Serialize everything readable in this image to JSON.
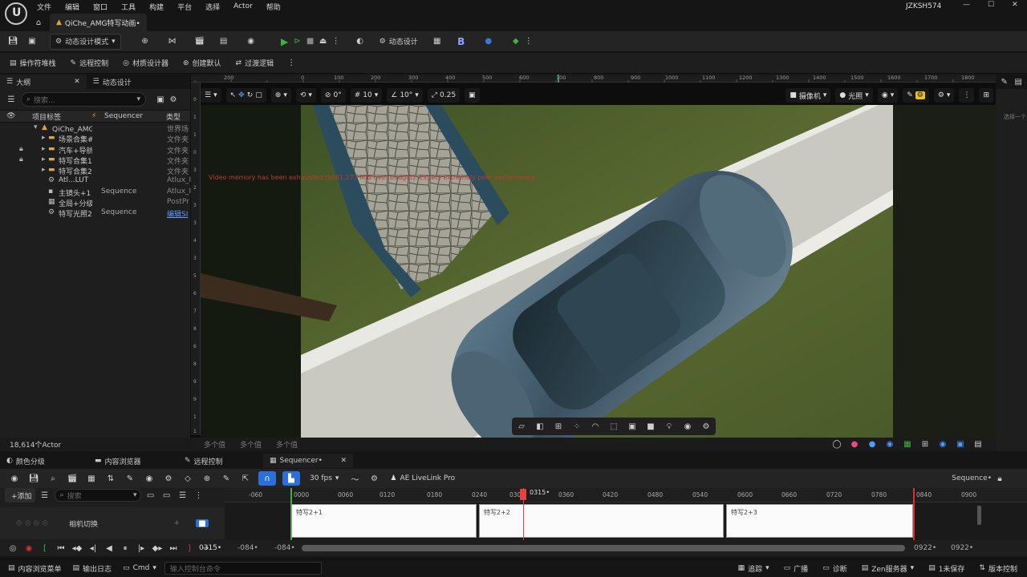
{
  "menu": [
    "文件",
    "编辑",
    "窗口",
    "工具",
    "构建",
    "平台",
    "选择",
    "Actor",
    "帮助"
  ],
  "user": "JZKSH574",
  "window_controls": [
    "—",
    "☐",
    "✕"
  ],
  "doc_tab": "QiChe_AMG特写动画•",
  "toolbar1": {
    "mode": "动态设计模式",
    "mode_label": "动态设计",
    "b_label": "B"
  },
  "toolbar2": [
    "操作符堆栈",
    "远程控制",
    "材质设计器",
    "创建默认",
    "过渡逻辑"
  ],
  "outliner": {
    "tab_outline": "大纲",
    "tab_motion": "动态设计",
    "search_placeholder": "搜索...",
    "col_label": "项目标签",
    "col_seq": "Sequencer",
    "col_type": "类型",
    "rows": [
      {
        "name": "QiChe_AMG特",
        "seq": "",
        "type": "世界场"
      },
      {
        "name": "场景合集#",
        "seq": "",
        "type": "文件夹"
      },
      {
        "name": "汽车+导航",
        "seq": "",
        "type": "文件夹"
      },
      {
        "name": "特写合集1",
        "seq": "",
        "type": "文件夹"
      },
      {
        "name": "特写合集2",
        "seq": "",
        "type": "文件夹"
      },
      {
        "name": "Atl...LUT",
        "seq": "",
        "type": "Atlux_I"
      },
      {
        "name": "主镜头+1",
        "seq": "Sequence",
        "type": "Atlux_I"
      },
      {
        "name": "全局+分级",
        "seq": "",
        "type": "PostPr"
      },
      {
        "name": "特写光照2",
        "seq": "Sequence",
        "type": "编辑SI"
      }
    ],
    "actor_count": "18,614个Actor"
  },
  "viewport": {
    "ruler_top": [
      "200",
      "0",
      "100",
      "200",
      "300",
      "400",
      "500",
      "600",
      "700",
      "800",
      "900",
      "1000",
      "1100",
      "1200",
      "1300",
      "1400",
      "1500",
      "1600",
      "1700",
      "1800"
    ],
    "ruler_left": [
      "0",
      "1",
      "1",
      "0",
      "3",
      "2",
      "3",
      "3",
      "4",
      "3",
      "5",
      "6",
      "7",
      "8",
      "6",
      "8",
      "9",
      "9",
      "1",
      "1"
    ],
    "grid_num": "0°",
    "snap_a": "10",
    "snap_b": "10°",
    "scale": "0.25",
    "camera": "摄像机",
    "lighting": "光照",
    "warning": "Video memory has been exhausted (5041.277 MiB over budget). Expect extremely poor performance.",
    "status_fields": [
      "多个值",
      "多个值",
      "多个值"
    ]
  },
  "right_panel": {
    "label": "选择一个"
  },
  "bottom_tabs": [
    "颜色分级",
    "内容浏览器",
    "远程控制",
    "Sequencer•"
  ],
  "sequencer": {
    "add_label": "+添加",
    "search_placeholder": "搜索",
    "fps": "30 fps",
    "livelink": "AE LiveLink Pro",
    "sequence_name": "Sequence•",
    "track_name": "相机切换",
    "playhead": "0315•",
    "ticks": [
      "-060",
      "0000",
      "0060",
      "0120",
      "0180",
      "0240",
      "0300",
      "0360",
      "0420",
      "0480",
      "0540",
      "0600",
      "0660",
      "0720",
      "0780",
      "0840",
      "0900"
    ],
    "clips": [
      "特写2+1",
      "特写2+2",
      "特写2+3"
    ],
    "current_frame": "0315•",
    "range_start_a": "-084•",
    "range_start_b": "-084•",
    "range_end_a": "0922•",
    "range_end_b": "0922•"
  },
  "statusbar": {
    "content_drawer": "内容浏览菜单",
    "output_log": "输出日志",
    "cmd": "Cmd",
    "cmd_placeholder": "输入控制台命令",
    "trace": "追踪",
    "broadcast": "广播",
    "diagnostics": "诊断",
    "zen": "Zen服务器",
    "unsaved": "1未保存",
    "source_control": "版本控制"
  }
}
